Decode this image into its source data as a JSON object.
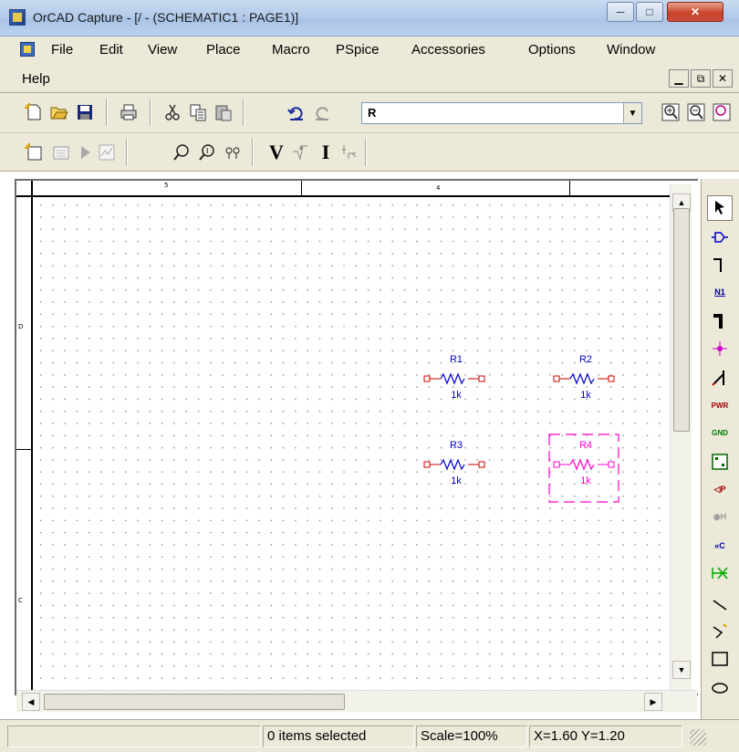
{
  "window": {
    "title": "OrCAD Capture - [/ - (SCHEMATIC1 : PAGE1)]",
    "icon": "orcad-app-icon",
    "controls": [
      "minimize-icon",
      "maximize-icon",
      "close-icon"
    ]
  },
  "menubar": {
    "items": [
      "File",
      "Edit",
      "View",
      "Place",
      "Macro",
      "PSpice",
      "Accessories",
      "Options",
      "Window",
      "Help"
    ],
    "mdi_controls": [
      "_",
      "̅Ǫ",
      "x"
    ]
  },
  "toolbar": {
    "part_combo_value": "R",
    "icons1": [
      "new-icon",
      "open-icon",
      "save-icon",
      "print-icon",
      "cut-icon",
      "copy-icon",
      "paste-icon",
      "undo-icon",
      "redo-icon",
      "zoom-in-icon",
      "zoom-out-icon",
      "zoom-area-icon"
    ],
    "icons2": [
      "new-simulation-icon",
      "edit-simulation-icon",
      "run-icon",
      "view-results-icon",
      "probe-icon",
      "probe2-icon",
      "bias-icon",
      "voltage-marker-icon",
      "voltage-diff-marker-icon",
      "current-marker-icon",
      "power-marker-icon"
    ],
    "marker_v": "V",
    "marker_i": "I"
  },
  "ruler": {
    "top_labels": [
      "5",
      "4"
    ],
    "left_labels": [
      "D",
      "C"
    ]
  },
  "schematic": {
    "parts": [
      {
        "name": "R1",
        "value": "1k",
        "selected": false
      },
      {
        "name": "R2",
        "value": "1k",
        "selected": false
      },
      {
        "name": "R3",
        "value": "1k",
        "selected": false
      },
      {
        "name": "R4",
        "value": "1k",
        "selected": true
      }
    ],
    "colors": {
      "part": "#0000cc",
      "pin": "#cc0000",
      "selected": "#ff00cc"
    }
  },
  "palette": {
    "tools": [
      {
        "name": "select-icon",
        "label": ""
      },
      {
        "name": "place-part-icon",
        "label": ""
      },
      {
        "name": "place-wire-icon",
        "label": ""
      },
      {
        "name": "place-net-alias-icon",
        "label": "N1"
      },
      {
        "name": "place-bus-icon",
        "label": ""
      },
      {
        "name": "place-junction-icon",
        "label": ""
      },
      {
        "name": "place-bus-entry-icon",
        "label": ""
      },
      {
        "name": "place-power-icon",
        "label": "PWR"
      },
      {
        "name": "place-ground-icon",
        "label": "GND"
      },
      {
        "name": "place-hierarchical-block-icon",
        "label": ""
      },
      {
        "name": "place-port-icon",
        "label": "P"
      },
      {
        "name": "place-pin-icon",
        "label": "H"
      },
      {
        "name": "place-off-page-connector-icon",
        "label": "C"
      },
      {
        "name": "place-no-connect-icon",
        "label": ""
      },
      {
        "name": "place-line-icon",
        "label": ""
      },
      {
        "name": "place-polyline-icon",
        "label": ""
      },
      {
        "name": "place-rectangle-icon",
        "label": ""
      },
      {
        "name": "place-ellipse-icon",
        "label": ""
      }
    ]
  },
  "statusbar": {
    "items_selected": "0 items selected",
    "scale": "Scale=100%",
    "coords": "X=1.60  Y=1.20"
  }
}
